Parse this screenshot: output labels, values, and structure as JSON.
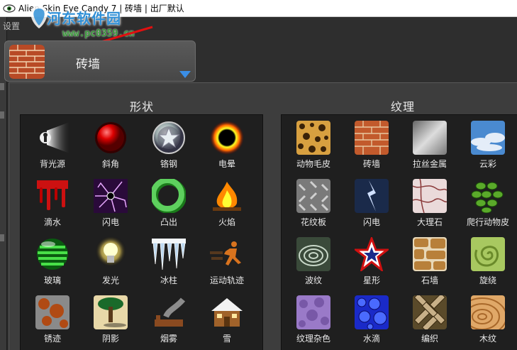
{
  "window": {
    "title": "Alien Skin Eye Candy 7 | 砖墙 | 出厂默认"
  },
  "sidebar": {
    "settings_tab": "设置"
  },
  "watermark": {
    "text": "河东软件园",
    "url": "www.pc0359.cn"
  },
  "preset": {
    "label": "砖墙",
    "icon": "brick-wall-icon"
  },
  "shapes": {
    "header": "形状",
    "items": [
      {
        "label": "背光源",
        "icon": "backlight-icon"
      },
      {
        "label": "斜角",
        "icon": "bevel-icon"
      },
      {
        "label": "铬钢",
        "icon": "chrome-icon"
      },
      {
        "label": "电晕",
        "icon": "corona-icon"
      },
      {
        "label": "滴水",
        "icon": "drip-icon"
      },
      {
        "label": "闪电",
        "icon": "lightning-icon"
      },
      {
        "label": "凸出",
        "icon": "extrude-icon"
      },
      {
        "label": "火焰",
        "icon": "fire-icon"
      },
      {
        "label": "玻璃",
        "icon": "glass-icon"
      },
      {
        "label": "发光",
        "icon": "glow-icon"
      },
      {
        "label": "冰柱",
        "icon": "icicles-icon"
      },
      {
        "label": "运动轨迹",
        "icon": "motion-trail-icon"
      },
      {
        "label": "锈迹",
        "icon": "rust-icon"
      },
      {
        "label": "阴影",
        "icon": "shadow-icon"
      },
      {
        "label": "烟雾",
        "icon": "smoke-icon"
      },
      {
        "label": "雪",
        "icon": "snow-icon"
      }
    ]
  },
  "textures": {
    "header": "纹理",
    "items": [
      {
        "label": "动物毛皮",
        "icon": "animal-fur-icon"
      },
      {
        "label": "砖墙",
        "icon": "brick-wall-icon"
      },
      {
        "label": "拉丝金属",
        "icon": "brushed-metal-icon"
      },
      {
        "label": "云彩",
        "icon": "clouds-icon"
      },
      {
        "label": "花纹板",
        "icon": "diamond-plate-icon"
      },
      {
        "label": "闪电",
        "icon": "lightning-texture-icon"
      },
      {
        "label": "大理石",
        "icon": "marble-icon"
      },
      {
        "label": "爬行动物皮",
        "icon": "reptile-skin-icon"
      },
      {
        "label": "波纹",
        "icon": "ripples-icon"
      },
      {
        "label": "星形",
        "icon": "star-icon"
      },
      {
        "label": "石墙",
        "icon": "stone-wall-icon"
      },
      {
        "label": "旋绕",
        "icon": "swirl-icon"
      },
      {
        "label": "纹理杂色",
        "icon": "texture-noise-icon"
      },
      {
        "label": "水滴",
        "icon": "water-drops-icon"
      },
      {
        "label": "编织",
        "icon": "weave-icon"
      },
      {
        "label": "木纹",
        "icon": "wood-icon"
      }
    ]
  },
  "colors": {
    "accent": "#2f8fd6",
    "panel": "#3d3d3d",
    "grid": "#1f1f1f"
  }
}
